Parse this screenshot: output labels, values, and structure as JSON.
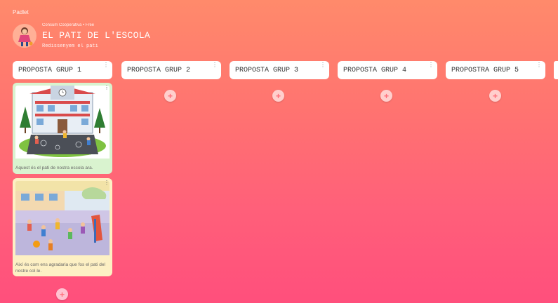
{
  "app": {
    "brand": "Padlet"
  },
  "header": {
    "meta": "Consum Cooperativa • Free",
    "title": "EL PATI DE L'ESCOLA",
    "subtitle": "Redissenyem el pati"
  },
  "columns": [
    {
      "title": "PROPOSTA GRUP 1"
    },
    {
      "title": "PROPOSTA GRUP 2"
    },
    {
      "title": "PROPOSTA GRUP 3"
    },
    {
      "title": "PROPOSTA GRUP 4"
    },
    {
      "title": "PROPOSTRA GRUP 5"
    }
  ],
  "posts": [
    {
      "caption": "Aquest és el pati de nostra escola ara."
    },
    {
      "caption": "Així és com ens agradaria que fos el pati del nostre col·le."
    }
  ],
  "icons": {
    "add": "+",
    "more": "⋮"
  },
  "colors": {
    "bg_top": "#ff8a6b",
    "bg_bottom": "#ff4f7c",
    "post1_bg": "#d9f3cf",
    "post2_bg": "#fdf0c4"
  }
}
